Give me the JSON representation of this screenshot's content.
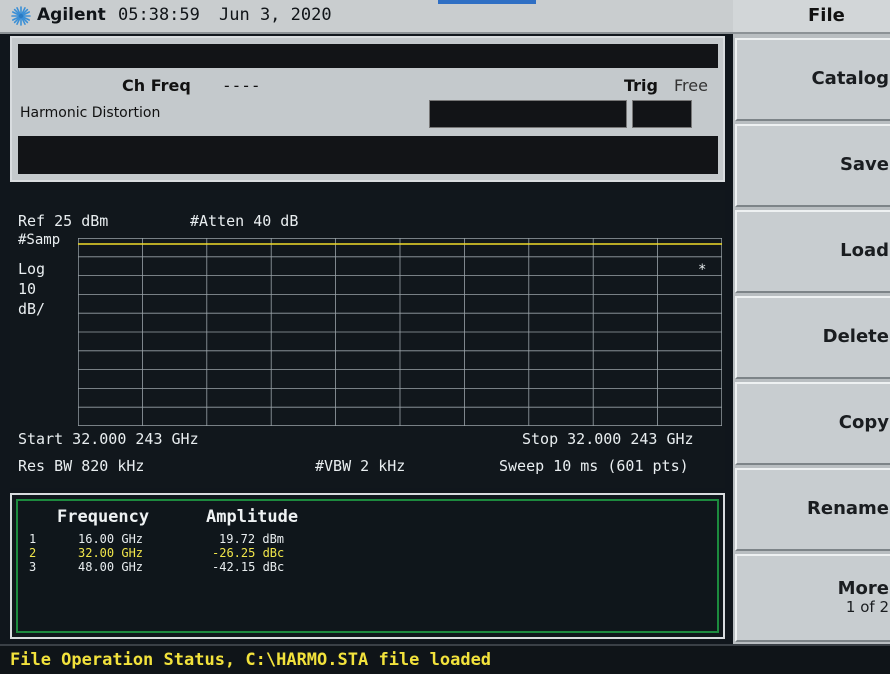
{
  "status_bar": {
    "brand": "Agilent",
    "time": "05:38:59",
    "date": "Jun 3, 2020"
  },
  "header": {
    "ch_freq_label": "Ch Freq",
    "ch_freq_value": "----",
    "trig_label": "Trig",
    "trig_value": "Free",
    "measurement": "Harmonic Distortion"
  },
  "spectrum": {
    "ref_level": "Ref 25 dBm",
    "atten": "#Atten 40 dB",
    "detector": "#Samp",
    "scale_type": "Log",
    "scale_value": "10",
    "scale_unit": "dB/",
    "marker_symbol": "*",
    "start_freq": "Start 32.000 243 GHz",
    "stop_freq": "Stop 32.000 243 GHz",
    "res_bw": "Res BW 820 kHz",
    "vbw": "#VBW 2 kHz",
    "sweep": "Sweep 10 ms (601 pts)",
    "trace_color": "#f0dc2a",
    "grid_color": "#9aa3a8"
  },
  "results": {
    "headers": {
      "frequency": "Frequency",
      "amplitude": "Amplitude"
    },
    "rows": [
      {
        "index": "1",
        "frequency": "16.00 GHz",
        "amplitude": "19.72 dBm"
      },
      {
        "index": "2",
        "frequency": "32.00 GHz",
        "amplitude": "-26.25 dBc"
      },
      {
        "index": "3",
        "frequency": "48.00 GHz",
        "amplitude": "-42.15 dBc"
      }
    ],
    "highlight_color": "#f1e64a",
    "border_color": "#1c8a3e"
  },
  "status_line": {
    "text": "File Operation Status, C:\\HARMO.STA file loaded",
    "color": "#f2e23c"
  },
  "softkey_menu": {
    "title": "File",
    "keys": [
      {
        "label": "Catalog"
      },
      {
        "label": "Save"
      },
      {
        "label": "Load"
      },
      {
        "label": "Delete"
      },
      {
        "label": "Copy"
      },
      {
        "label": "Rename"
      },
      {
        "label": "More",
        "sub": "1 of 2"
      }
    ]
  },
  "icons": {
    "logo": "agilent-starburst-icon"
  }
}
